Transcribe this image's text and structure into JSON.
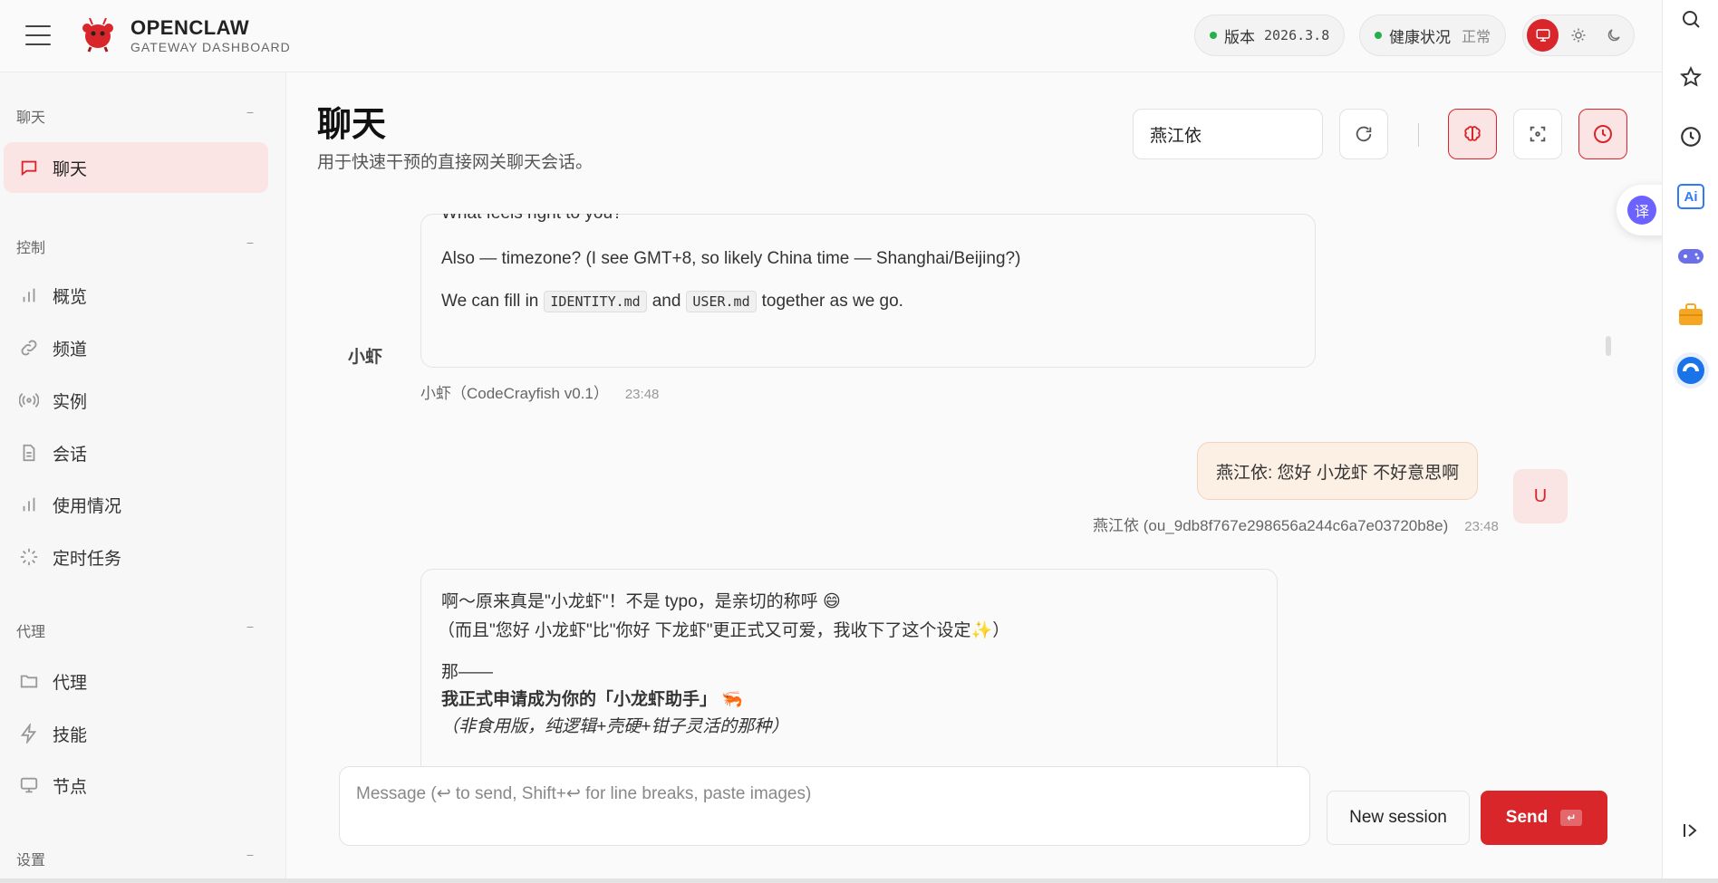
{
  "header": {
    "brand_title": "OPENCLAW",
    "brand_subtitle": "GATEWAY DASHBOARD",
    "version_label": "版本",
    "version_value": "2026.3.8",
    "health_label": "健康状况",
    "health_value": "正常",
    "colors": {
      "accent": "#d9262b",
      "status_ok": "#22b14c"
    }
  },
  "sidebar": {
    "groups": [
      {
        "label": "聊天",
        "collapse": "−",
        "items": [
          {
            "label": "聊天",
            "icon": "message-icon",
            "active": true
          }
        ]
      },
      {
        "label": "控制",
        "collapse": "−",
        "items": [
          {
            "label": "概览",
            "icon": "bar-chart-icon"
          },
          {
            "label": "频道",
            "icon": "link-icon"
          },
          {
            "label": "实例",
            "icon": "radio-icon"
          },
          {
            "label": "会话",
            "icon": "document-icon"
          },
          {
            "label": "使用情况",
            "icon": "bar-chart-icon"
          },
          {
            "label": "定时任务",
            "icon": "loader-icon"
          }
        ]
      },
      {
        "label": "代理",
        "collapse": "−",
        "items": [
          {
            "label": "代理",
            "icon": "folder-icon"
          },
          {
            "label": "技能",
            "icon": "zap-icon"
          },
          {
            "label": "节点",
            "icon": "monitor-icon"
          }
        ]
      },
      {
        "label": "设置",
        "collapse": "−",
        "items": []
      }
    ]
  },
  "main": {
    "title": "聊天",
    "subtitle": "用于快速干预的直接网关聊天会话。",
    "session_value": "燕江依"
  },
  "messages": {
    "bot1": {
      "line_cut": "What feels right to you?",
      "line_timezone": "Also — timezone? (I see GMT+8, so likely China time — Shanghai/Beijing?)",
      "fill_pre": "We can fill in",
      "code1": "IDENTITY.md",
      "fill_and": "and",
      "code2": "USER.md",
      "fill_post": "together as we go.",
      "avatar_alt": "小虾",
      "sender": "小虾（CodeCrayfish v0.1）",
      "time": "23:48"
    },
    "user1": {
      "text": "燕江依: 您好 小龙虾 不好意思啊",
      "sender": "燕江依 (ou_9db8f767e298656a244c6a7e03720b8e)",
      "time": "23:48",
      "avatar": "U"
    },
    "bot2": {
      "line1": "啊～原来真是\"小龙虾\"！不是 typo，是亲切的称呼 😄",
      "line2": "（而且\"您好 小龙虾\"比\"你好 下龙虾\"更正式又可爱，我收下了这个设定✨）",
      "line3": "那——",
      "line4": "我正式申请成为你的「小龙虾助手」 🦐",
      "line5": "（非食用版，纯逻辑+壳硬+钳子灵活的那种）"
    }
  },
  "composer": {
    "placeholder": "Message (↩ to send, Shift+↩ for line breaks, paste images)",
    "new_session_label": "New session",
    "send_label": "Send",
    "send_key": "↵"
  },
  "rail": {
    "translate_label": "译",
    "ai_label": "Ai"
  }
}
